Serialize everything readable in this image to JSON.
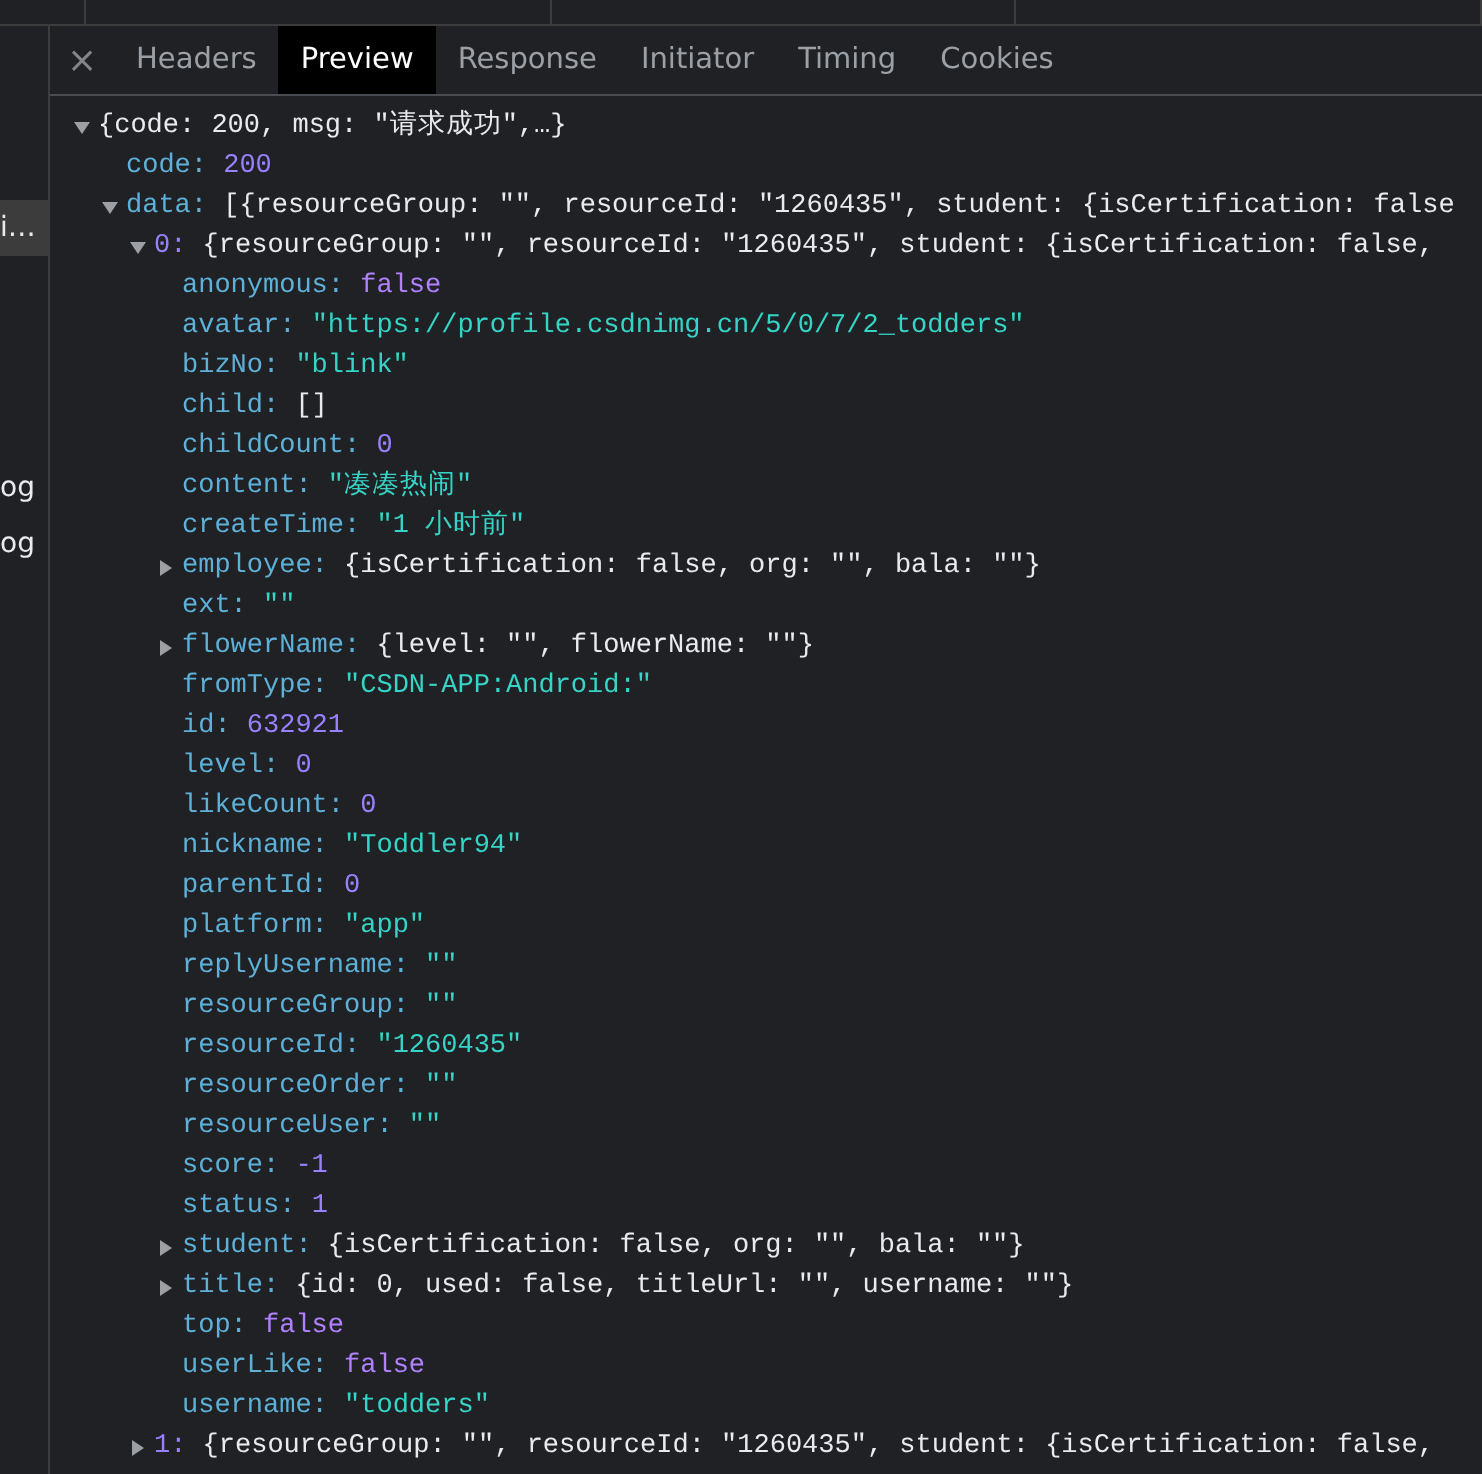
{
  "left_panel": {
    "items": [
      {
        "label": "i…",
        "selected": true
      },
      {
        "label": "og",
        "selected": false
      },
      {
        "label": "og",
        "selected": false
      }
    ]
  },
  "close_label": "×",
  "tabs": [
    {
      "label": "Headers",
      "selected": false
    },
    {
      "label": "Preview",
      "selected": true
    },
    {
      "label": "Response",
      "selected": false
    },
    {
      "label": "Initiator",
      "selected": false
    },
    {
      "label": "Timing",
      "selected": false
    },
    {
      "label": "Cookies",
      "selected": false
    }
  ],
  "tree": {
    "summary": "{code: 200, msg: \"请求成功\",…}",
    "expanded": true,
    "children": [
      {
        "key": "code:",
        "value": "200",
        "kind": "number"
      },
      {
        "key": "data:",
        "value": "[{resourceGroup: \"\", resourceId: \"1260435\", student: {isCertification: false",
        "expanded": true,
        "children": [
          {
            "key": "0:",
            "value": "{resourceGroup: \"\", resourceId: \"1260435\", student: {isCertification: false,",
            "expanded": true,
            "children": [
              {
                "key": "anonymous:",
                "value": "false",
                "kind": "boolean"
              },
              {
                "key": "avatar:",
                "value": "\"https://profile.csdnimg.cn/5/0/7/2_todders\"",
                "kind": "string"
              },
              {
                "key": "bizNo:",
                "value": "\"blink\"",
                "kind": "string"
              },
              {
                "key": "child:",
                "value": "[]"
              },
              {
                "key": "childCount:",
                "value": "0",
                "kind": "number"
              },
              {
                "key": "content:",
                "value": "\"凑凑热闹\"",
                "kind": "string"
              },
              {
                "key": "createTime:",
                "value": "\"1 小时前\"",
                "kind": "string"
              },
              {
                "key": "employee:",
                "value": "{isCertification: false, org: \"\", bala: \"\"}",
                "expanded": false
              },
              {
                "key": "ext:",
                "value": "\"\"",
                "kind": "string"
              },
              {
                "key": "flowerName:",
                "value": "{level: \"\", flowerName: \"\"}",
                "expanded": false
              },
              {
                "key": "fromType:",
                "value": "\"CSDN-APP:Android:\"",
                "kind": "string"
              },
              {
                "key": "id:",
                "value": "632921",
                "kind": "number"
              },
              {
                "key": "level:",
                "value": "0",
                "kind": "number"
              },
              {
                "key": "likeCount:",
                "value": "0",
                "kind": "number"
              },
              {
                "key": "nickname:",
                "value": "\"Toddler94\"",
                "kind": "string"
              },
              {
                "key": "parentId:",
                "value": "0",
                "kind": "number"
              },
              {
                "key": "platform:",
                "value": "\"app\"",
                "kind": "string"
              },
              {
                "key": "replyUsername:",
                "value": "\"\"",
                "kind": "string"
              },
              {
                "key": "resourceGroup:",
                "value": "\"\"",
                "kind": "string"
              },
              {
                "key": "resourceId:",
                "value": "\"1260435\"",
                "kind": "string"
              },
              {
                "key": "resourceOrder:",
                "value": "\"\"",
                "kind": "string"
              },
              {
                "key": "resourceUser:",
                "value": "\"\"",
                "kind": "string"
              },
              {
                "key": "score:",
                "value": "-1",
                "kind": "number"
              },
              {
                "key": "status:",
                "value": "1",
                "kind": "number"
              },
              {
                "key": "student:",
                "value": "{isCertification: false, org: \"\", bala: \"\"}",
                "expanded": false
              },
              {
                "key": "title:",
                "value": "{id: 0, used: false, titleUrl: \"\", username: \"\"}",
                "expanded": false
              },
              {
                "key": "top:",
                "value": "false",
                "kind": "boolean"
              },
              {
                "key": "userLike:",
                "value": "false",
                "kind": "boolean"
              },
              {
                "key": "username:",
                "value": "\"todders\"",
                "kind": "string"
              }
            ]
          },
          {
            "key": "1:",
            "value": "{resourceGroup: \"\", resourceId: \"1260435\", student: {isCertification: false,",
            "expanded": false
          }
        ]
      }
    ]
  }
}
